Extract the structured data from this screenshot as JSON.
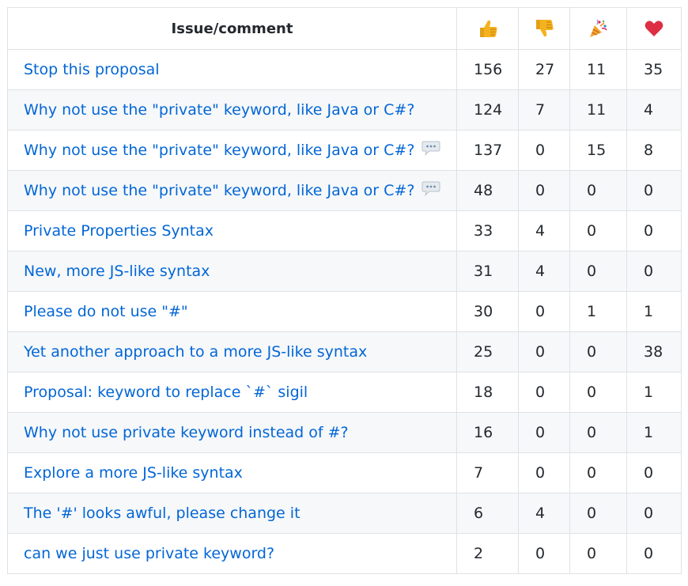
{
  "table": {
    "header": {
      "title": "Issue/comment",
      "reactions": [
        {
          "name": "thumbs-up-icon"
        },
        {
          "name": "thumbs-down-icon"
        },
        {
          "name": "party-popper-icon"
        },
        {
          "name": "heart-icon"
        }
      ]
    },
    "rows": [
      {
        "title": "Stop this proposal",
        "comment_icon": false,
        "up": "156",
        "down": "27",
        "hooray": "11",
        "heart": "35"
      },
      {
        "title": "Why not use the \"private\" keyword, like Java or C#?",
        "comment_icon": false,
        "up": "124",
        "down": "7",
        "hooray": "11",
        "heart": "4"
      },
      {
        "title": "Why not use the \"private\" keyword, like Java or C#?",
        "comment_icon": true,
        "up": "137",
        "down": "0",
        "hooray": "15",
        "heart": "8"
      },
      {
        "title": "Why not use the \"private\" keyword, like Java or C#?",
        "comment_icon": true,
        "up": "48",
        "down": "0",
        "hooray": "0",
        "heart": "0"
      },
      {
        "title": "Private Properties Syntax",
        "comment_icon": false,
        "up": "33",
        "down": "4",
        "hooray": "0",
        "heart": "0"
      },
      {
        "title": "New, more JS-like syntax",
        "comment_icon": false,
        "up": "31",
        "down": "4",
        "hooray": "0",
        "heart": "0"
      },
      {
        "title": "Please do not use \"#\"",
        "comment_icon": false,
        "up": "30",
        "down": "0",
        "hooray": "1",
        "heart": "1"
      },
      {
        "title": "Yet another approach to a more JS-like syntax",
        "comment_icon": false,
        "up": "25",
        "down": "0",
        "hooray": "0",
        "heart": "38"
      },
      {
        "title": "Proposal: keyword to replace `#` sigil",
        "comment_icon": false,
        "up": "18",
        "down": "0",
        "hooray": "0",
        "heart": "1"
      },
      {
        "title": "Why not use private keyword instead of #?",
        "comment_icon": false,
        "up": "16",
        "down": "0",
        "hooray": "0",
        "heart": "1"
      },
      {
        "title": "Explore a more JS-like syntax",
        "comment_icon": false,
        "up": "7",
        "down": "0",
        "hooray": "0",
        "heart": "0"
      },
      {
        "title": "The '#' looks awful, please change it",
        "comment_icon": false,
        "up": "6",
        "down": "4",
        "hooray": "0",
        "heart": "0"
      },
      {
        "title": "can we just use private keyword?",
        "comment_icon": false,
        "up": "2",
        "down": "0",
        "hooray": "0",
        "heart": "0"
      }
    ]
  },
  "colors": {
    "link": "#0366d6",
    "border": "#dfe2e5",
    "stripe": "#f6f8fa",
    "text": "#24292e"
  }
}
